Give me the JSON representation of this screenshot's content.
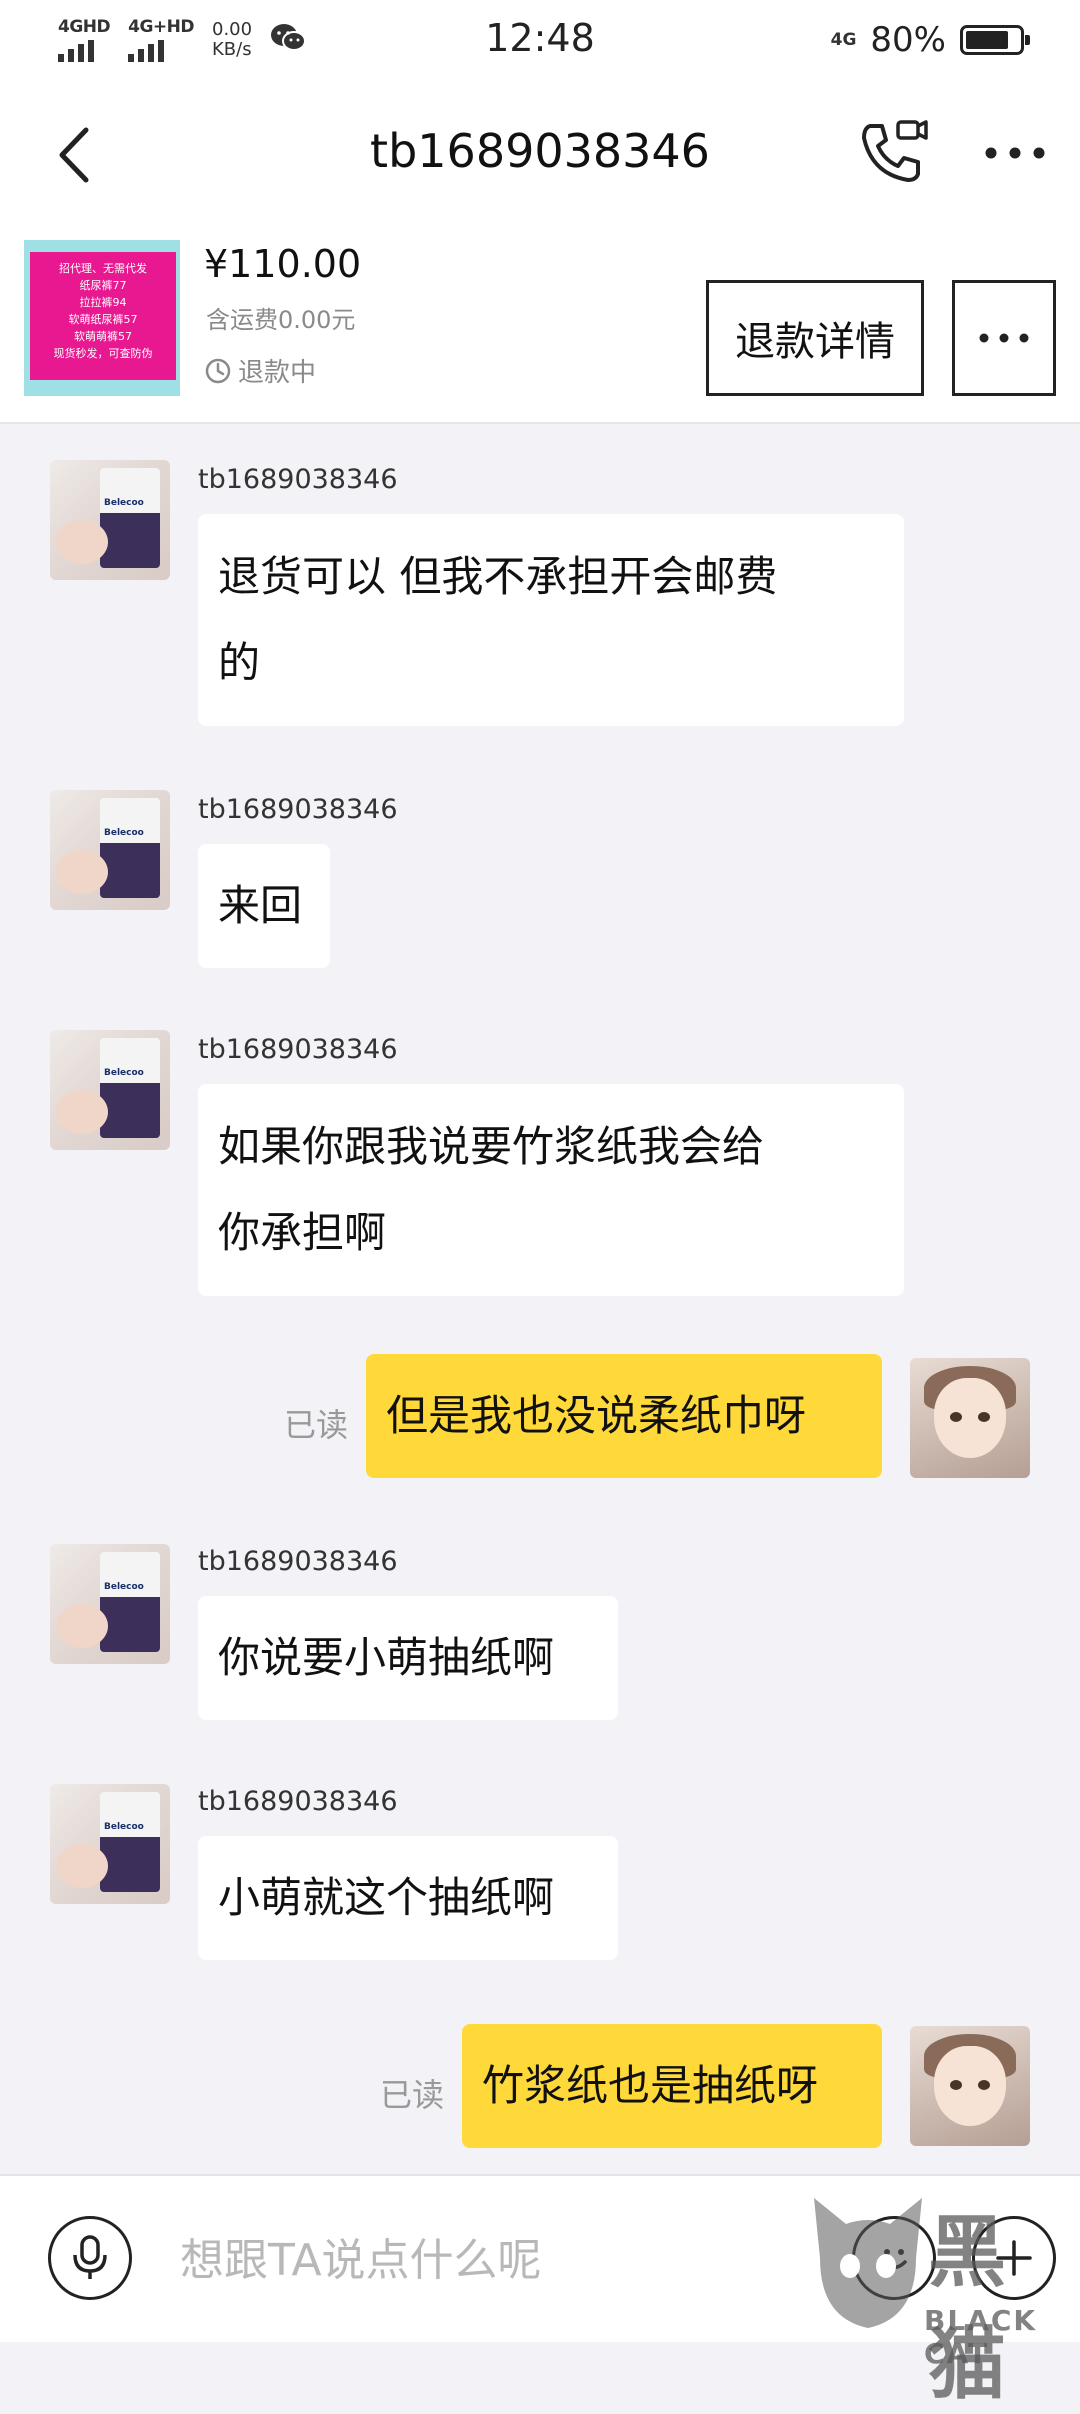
{
  "status_bar": {
    "network1": "4GHD",
    "network2": "4G+HD",
    "speed_value": "0.00",
    "speed_unit": "KB/s",
    "time": "12:48",
    "network_right": "4G",
    "battery_percent": "80%",
    "battery_level": 0.8
  },
  "header": {
    "title": "tb1689038346",
    "back_icon": "chevron-left-icon",
    "call_icon": "video-call-icon",
    "more_icon": "more-dots-icon"
  },
  "order": {
    "thumbnail_lines": [
      "招代理、无需代发",
      "纸尿裤77",
      "拉拉裤94",
      "软萌纸尿裤57",
      "软萌萌裤57",
      "现货秒发，可查防伪"
    ],
    "price": "¥110.00",
    "shipping": "含运费0.00元",
    "status": "退款中",
    "refund_button": "退款详情"
  },
  "messages": [
    {
      "from": "seller",
      "sender": "tb1689038346",
      "lines": [
        "退货可以 但我不承担开会邮费",
        "的"
      ]
    },
    {
      "from": "seller",
      "sender": "tb1689038346",
      "lines": [
        "来回"
      ]
    },
    {
      "from": "seller",
      "sender": "tb1689038346",
      "lines": [
        "如果你跟我说要竹浆纸我会给",
        "你承担啊"
      ]
    },
    {
      "from": "me",
      "read_label": "已读",
      "lines": [
        "但是我也没说柔纸巾呀"
      ]
    },
    {
      "from": "seller",
      "sender": "tb1689038346",
      "lines": [
        "你说要小萌抽纸啊"
      ]
    },
    {
      "from": "seller",
      "sender": "tb1689038346",
      "lines": [
        "小萌就这个抽纸啊"
      ]
    },
    {
      "from": "me",
      "read_label": "已读",
      "lines": [
        "竹浆纸也是抽纸呀"
      ]
    }
  ],
  "input": {
    "placeholder": "想跟TA说点什么呢",
    "mic_icon": "microphone-icon",
    "emoji_icon": "emoji-icon",
    "plus_icon": "plus-icon"
  },
  "watermark": {
    "main": "黑猫",
    "sub": "BLACK CAT"
  },
  "colors": {
    "my_bubble": "#ffd93a",
    "their_bubble": "#ffffff",
    "chat_bg": "#f2f2f7"
  }
}
